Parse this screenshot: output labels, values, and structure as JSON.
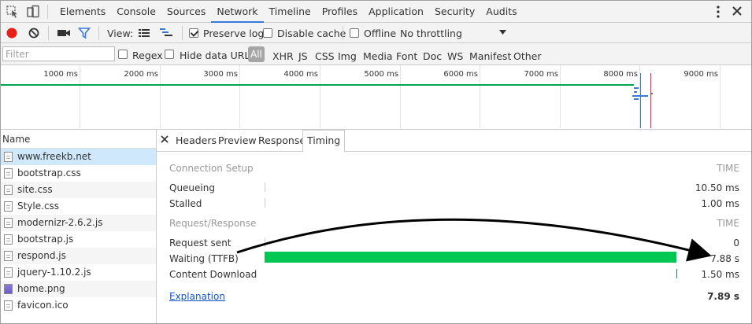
{
  "main_tabs": [
    "Elements",
    "Console",
    "Sources",
    "Network",
    "Timeline",
    "Profiles",
    "Application",
    "Security",
    "Audits"
  ],
  "active_main_tab": "Network",
  "toolbar": {
    "view_label": "View:",
    "preserve_log_label": "Preserve log",
    "preserve_log_checked": true,
    "disable_cache_label": "Disable cache",
    "disable_cache_checked": false,
    "offline_label": "Offline",
    "offline_checked": false,
    "throttling_value": "No throttling"
  },
  "filterbar": {
    "filter_placeholder": "Filter",
    "regex_label": "Regex",
    "hide_data_urls_label": "Hide data URLs",
    "types": [
      "All",
      "XHR",
      "JS",
      "CSS",
      "Img",
      "Media",
      "Font",
      "Doc",
      "WS",
      "Manifest",
      "Other"
    ],
    "active_type": "All"
  },
  "overview": {
    "tick_labels": [
      "1000 ms",
      "2000 ms",
      "3000 ms",
      "4000 ms",
      "5000 ms",
      "6000 ms",
      "7000 ms",
      "8000 ms",
      "9000 ms"
    ]
  },
  "request_list": {
    "header": "Name",
    "items": [
      {
        "name": "www.freekb.net",
        "type": "doc",
        "selected": true
      },
      {
        "name": "bootstrap.css",
        "type": "doc"
      },
      {
        "name": "site.css",
        "type": "doc"
      },
      {
        "name": "Style.css",
        "type": "doc"
      },
      {
        "name": "modernizr-2.6.2.js",
        "type": "doc"
      },
      {
        "name": "bootstrap.js",
        "type": "doc"
      },
      {
        "name": "respond.js",
        "type": "doc"
      },
      {
        "name": "jquery-1.10.2.js",
        "type": "doc"
      },
      {
        "name": "home.png",
        "type": "img"
      },
      {
        "name": "favicon.ico",
        "type": "doc"
      }
    ]
  },
  "detail_tabs": [
    "Headers",
    "Preview",
    "Response",
    "Timing"
  ],
  "active_detail_tab": "Timing",
  "timing": {
    "connection_setup": {
      "section": "Connection Setup",
      "time_header": "TIME",
      "rows": [
        {
          "label": "Queueing",
          "value": "10.50 ms"
        },
        {
          "label": "Stalled",
          "value": "1.00 ms"
        }
      ]
    },
    "request_response": {
      "section": "Request/Response",
      "time_header": "TIME",
      "rows": [
        {
          "label": "Request sent",
          "value": "0"
        },
        {
          "label": "Waiting (TTFB)",
          "value": "7.88 s"
        },
        {
          "label": "Content Download",
          "value": "1.50 ms"
        }
      ]
    },
    "explanation_link": "Explanation",
    "total": "7.89 s"
  },
  "colors": {
    "ttfb_bar": "#00c853",
    "record_button": "#e62117",
    "accent_tab": "#3879d9",
    "link": "#1155cc"
  }
}
